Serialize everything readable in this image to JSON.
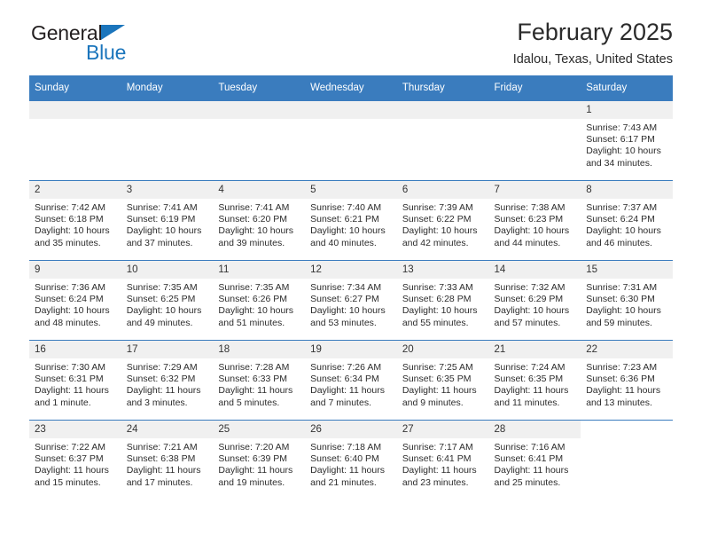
{
  "brand": {
    "name_part1": "General",
    "name_part2": "Blue",
    "triangle_color": "#1b75bc"
  },
  "header": {
    "title": "February 2025",
    "location": "Idalou, Texas, United States",
    "header_bg_color": "#3a7cbe",
    "daynum_bg_color": "#f0f0f0"
  },
  "weekdays": [
    "Sunday",
    "Monday",
    "Tuesday",
    "Wednesday",
    "Thursday",
    "Friday",
    "Saturday"
  ],
  "labels": {
    "sunrise": "Sunrise:",
    "sunset": "Sunset:",
    "daylight": "Daylight:"
  },
  "weeks": [
    [
      {
        "blank": true
      },
      {
        "blank": true
      },
      {
        "blank": true
      },
      {
        "blank": true
      },
      {
        "blank": true
      },
      {
        "blank": true
      },
      {
        "day": "1",
        "sunrise": "Sunrise: 7:43 AM",
        "sunset": "Sunset: 6:17 PM",
        "daylight": "Daylight: 10 hours and 34 minutes."
      }
    ],
    [
      {
        "day": "2",
        "sunrise": "Sunrise: 7:42 AM",
        "sunset": "Sunset: 6:18 PM",
        "daylight": "Daylight: 10 hours and 35 minutes."
      },
      {
        "day": "3",
        "sunrise": "Sunrise: 7:41 AM",
        "sunset": "Sunset: 6:19 PM",
        "daylight": "Daylight: 10 hours and 37 minutes."
      },
      {
        "day": "4",
        "sunrise": "Sunrise: 7:41 AM",
        "sunset": "Sunset: 6:20 PM",
        "daylight": "Daylight: 10 hours and 39 minutes."
      },
      {
        "day": "5",
        "sunrise": "Sunrise: 7:40 AM",
        "sunset": "Sunset: 6:21 PM",
        "daylight": "Daylight: 10 hours and 40 minutes."
      },
      {
        "day": "6",
        "sunrise": "Sunrise: 7:39 AM",
        "sunset": "Sunset: 6:22 PM",
        "daylight": "Daylight: 10 hours and 42 minutes."
      },
      {
        "day": "7",
        "sunrise": "Sunrise: 7:38 AM",
        "sunset": "Sunset: 6:23 PM",
        "daylight": "Daylight: 10 hours and 44 minutes."
      },
      {
        "day": "8",
        "sunrise": "Sunrise: 7:37 AM",
        "sunset": "Sunset: 6:24 PM",
        "daylight": "Daylight: 10 hours and 46 minutes."
      }
    ],
    [
      {
        "day": "9",
        "sunrise": "Sunrise: 7:36 AM",
        "sunset": "Sunset: 6:24 PM",
        "daylight": "Daylight: 10 hours and 48 minutes."
      },
      {
        "day": "10",
        "sunrise": "Sunrise: 7:35 AM",
        "sunset": "Sunset: 6:25 PM",
        "daylight": "Daylight: 10 hours and 49 minutes."
      },
      {
        "day": "11",
        "sunrise": "Sunrise: 7:35 AM",
        "sunset": "Sunset: 6:26 PM",
        "daylight": "Daylight: 10 hours and 51 minutes."
      },
      {
        "day": "12",
        "sunrise": "Sunrise: 7:34 AM",
        "sunset": "Sunset: 6:27 PM",
        "daylight": "Daylight: 10 hours and 53 minutes."
      },
      {
        "day": "13",
        "sunrise": "Sunrise: 7:33 AM",
        "sunset": "Sunset: 6:28 PM",
        "daylight": "Daylight: 10 hours and 55 minutes."
      },
      {
        "day": "14",
        "sunrise": "Sunrise: 7:32 AM",
        "sunset": "Sunset: 6:29 PM",
        "daylight": "Daylight: 10 hours and 57 minutes."
      },
      {
        "day": "15",
        "sunrise": "Sunrise: 7:31 AM",
        "sunset": "Sunset: 6:30 PM",
        "daylight": "Daylight: 10 hours and 59 minutes."
      }
    ],
    [
      {
        "day": "16",
        "sunrise": "Sunrise: 7:30 AM",
        "sunset": "Sunset: 6:31 PM",
        "daylight": "Daylight: 11 hours and 1 minute."
      },
      {
        "day": "17",
        "sunrise": "Sunrise: 7:29 AM",
        "sunset": "Sunset: 6:32 PM",
        "daylight": "Daylight: 11 hours and 3 minutes."
      },
      {
        "day": "18",
        "sunrise": "Sunrise: 7:28 AM",
        "sunset": "Sunset: 6:33 PM",
        "daylight": "Daylight: 11 hours and 5 minutes."
      },
      {
        "day": "19",
        "sunrise": "Sunrise: 7:26 AM",
        "sunset": "Sunset: 6:34 PM",
        "daylight": "Daylight: 11 hours and 7 minutes."
      },
      {
        "day": "20",
        "sunrise": "Sunrise: 7:25 AM",
        "sunset": "Sunset: 6:35 PM",
        "daylight": "Daylight: 11 hours and 9 minutes."
      },
      {
        "day": "21",
        "sunrise": "Sunrise: 7:24 AM",
        "sunset": "Sunset: 6:35 PM",
        "daylight": "Daylight: 11 hours and 11 minutes."
      },
      {
        "day": "22",
        "sunrise": "Sunrise: 7:23 AM",
        "sunset": "Sunset: 6:36 PM",
        "daylight": "Daylight: 11 hours and 13 minutes."
      }
    ],
    [
      {
        "day": "23",
        "sunrise": "Sunrise: 7:22 AM",
        "sunset": "Sunset: 6:37 PM",
        "daylight": "Daylight: 11 hours and 15 minutes."
      },
      {
        "day": "24",
        "sunrise": "Sunrise: 7:21 AM",
        "sunset": "Sunset: 6:38 PM",
        "daylight": "Daylight: 11 hours and 17 minutes."
      },
      {
        "day": "25",
        "sunrise": "Sunrise: 7:20 AM",
        "sunset": "Sunset: 6:39 PM",
        "daylight": "Daylight: 11 hours and 19 minutes."
      },
      {
        "day": "26",
        "sunrise": "Sunrise: 7:18 AM",
        "sunset": "Sunset: 6:40 PM",
        "daylight": "Daylight: 11 hours and 21 minutes."
      },
      {
        "day": "27",
        "sunrise": "Sunrise: 7:17 AM",
        "sunset": "Sunset: 6:41 PM",
        "daylight": "Daylight: 11 hours and 23 minutes."
      },
      {
        "day": "28",
        "sunrise": "Sunrise: 7:16 AM",
        "sunset": "Sunset: 6:41 PM",
        "daylight": "Daylight: 11 hours and 25 minutes."
      },
      {
        "empty": true
      }
    ]
  ]
}
